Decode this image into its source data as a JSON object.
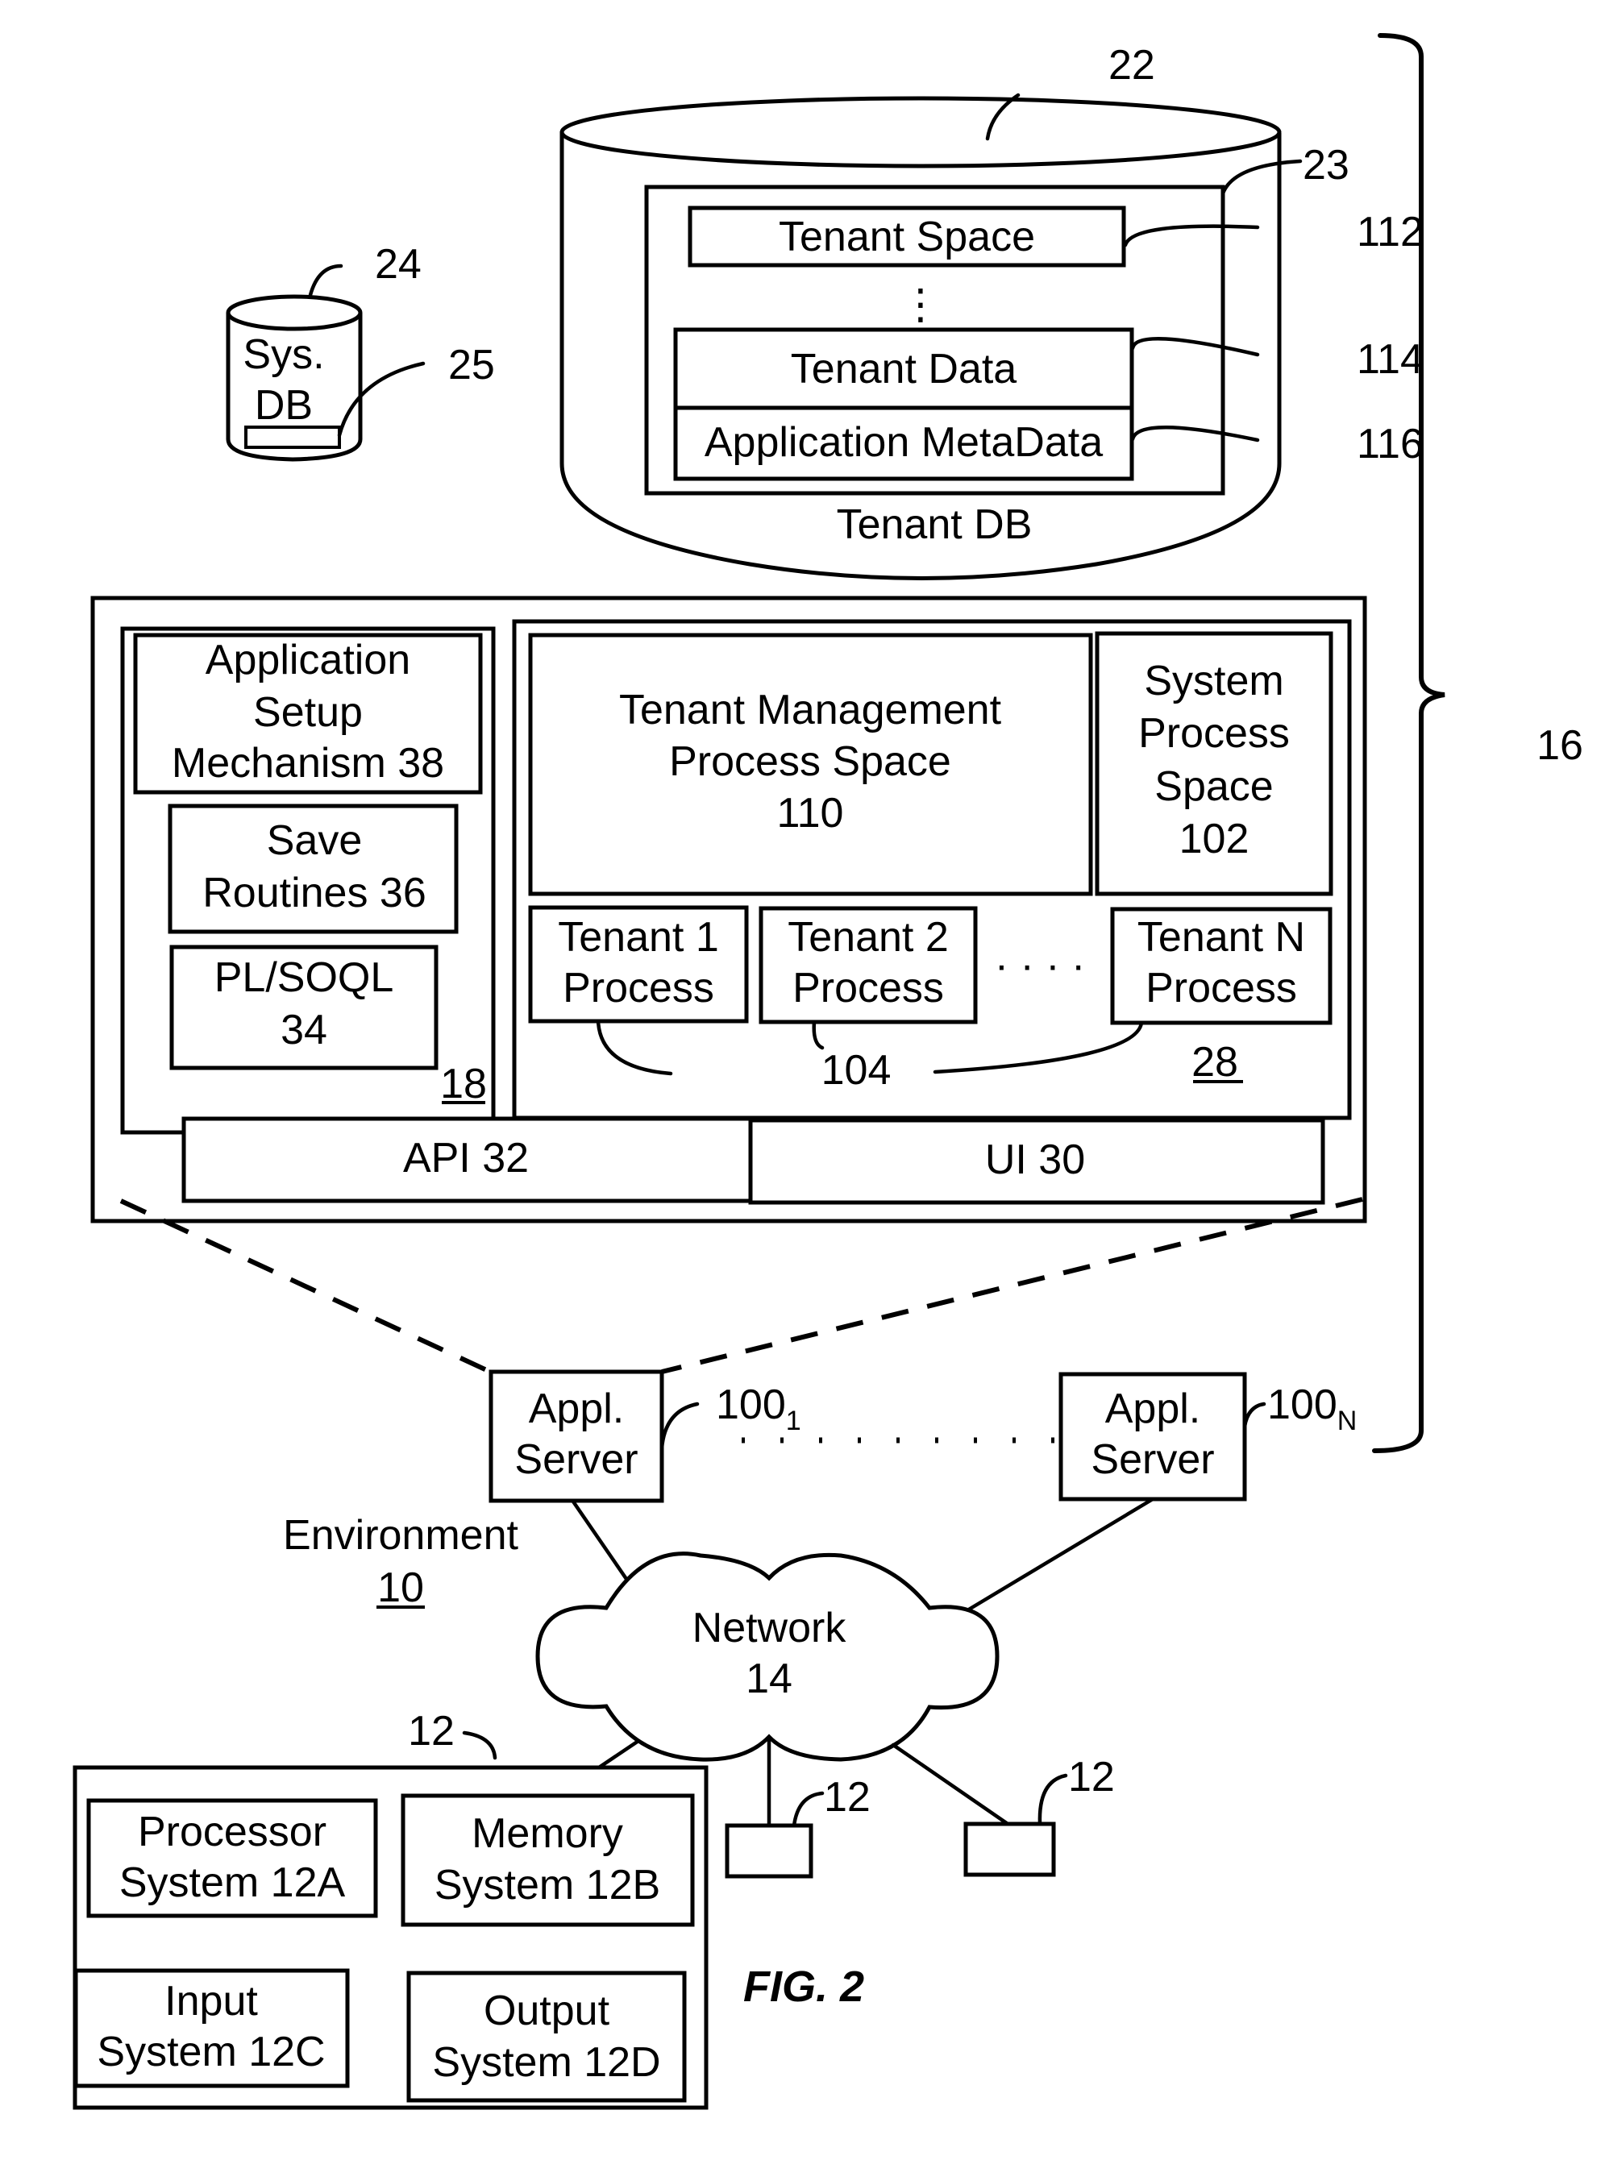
{
  "figure": {
    "title": "FIG. 2",
    "environment": {
      "label": "Environment",
      "ref": "10"
    },
    "system_ref": "16"
  },
  "tenant_db": {
    "label": "Tenant DB",
    "ref": "22",
    "storage_ref": "23",
    "tenant_space": {
      "label": "Tenant Space",
      "ref": "112"
    },
    "ellipsis": "⋮",
    "tenant_data": {
      "label": "Tenant Data",
      "ref": "114"
    },
    "app_metadata": {
      "label": "Application MetaData",
      "ref": "116"
    }
  },
  "system_db": {
    "label_line1": "Sys.",
    "label_line2": "DB",
    "ref": "24",
    "storage_ref": "25"
  },
  "app_server_detail": {
    "left_panel": {
      "ref": "18",
      "app_setup": {
        "line1": "Application",
        "line2": "Setup",
        "line3": "Mechanism 38"
      },
      "save_routines": {
        "line1": "Save",
        "line2": "Routines 36"
      },
      "plsoql": {
        "line1": "PL/SOQL",
        "line2": "34"
      }
    },
    "right_panel": {
      "ref": "28",
      "tenant_mgmt": {
        "line1": "Tenant Management",
        "line2": "Process Space",
        "line3": "110"
      },
      "system_process": {
        "line1": "System",
        "line2": "Process",
        "line3": "Space",
        "line4": "102"
      },
      "tenant_processes": [
        {
          "line1": "Tenant 1",
          "line2": "Process"
        },
        {
          "line1": "Tenant 2",
          "line2": "Process"
        },
        {
          "line1": "Tenant N",
          "line2": "Process"
        }
      ],
      "process_ellipsis": "· · · ·",
      "tenant_process_ref": "104"
    },
    "api": "API 32",
    "ui": "UI 30"
  },
  "servers": [
    {
      "line1": "Appl.",
      "line2": "Server",
      "ref_base": "100",
      "ref_sub": "1"
    },
    {
      "line1": "Appl.",
      "line2": "Server",
      "ref_base": "100",
      "ref_sub": "N"
    }
  ],
  "network": {
    "line1": "Network",
    "line2": "14"
  },
  "user_system": {
    "ref": "12",
    "processor": {
      "line1": "Processor",
      "line2": "System 12A"
    },
    "memory": {
      "line1": "Memory",
      "line2": "System 12B"
    },
    "input": {
      "line1": "Input",
      "line2": "System 12C"
    },
    "output": {
      "line1": "Output",
      "line2": "System 12D"
    }
  },
  "other_user_systems": [
    {
      "ref": "12"
    },
    {
      "ref": "12"
    }
  ]
}
